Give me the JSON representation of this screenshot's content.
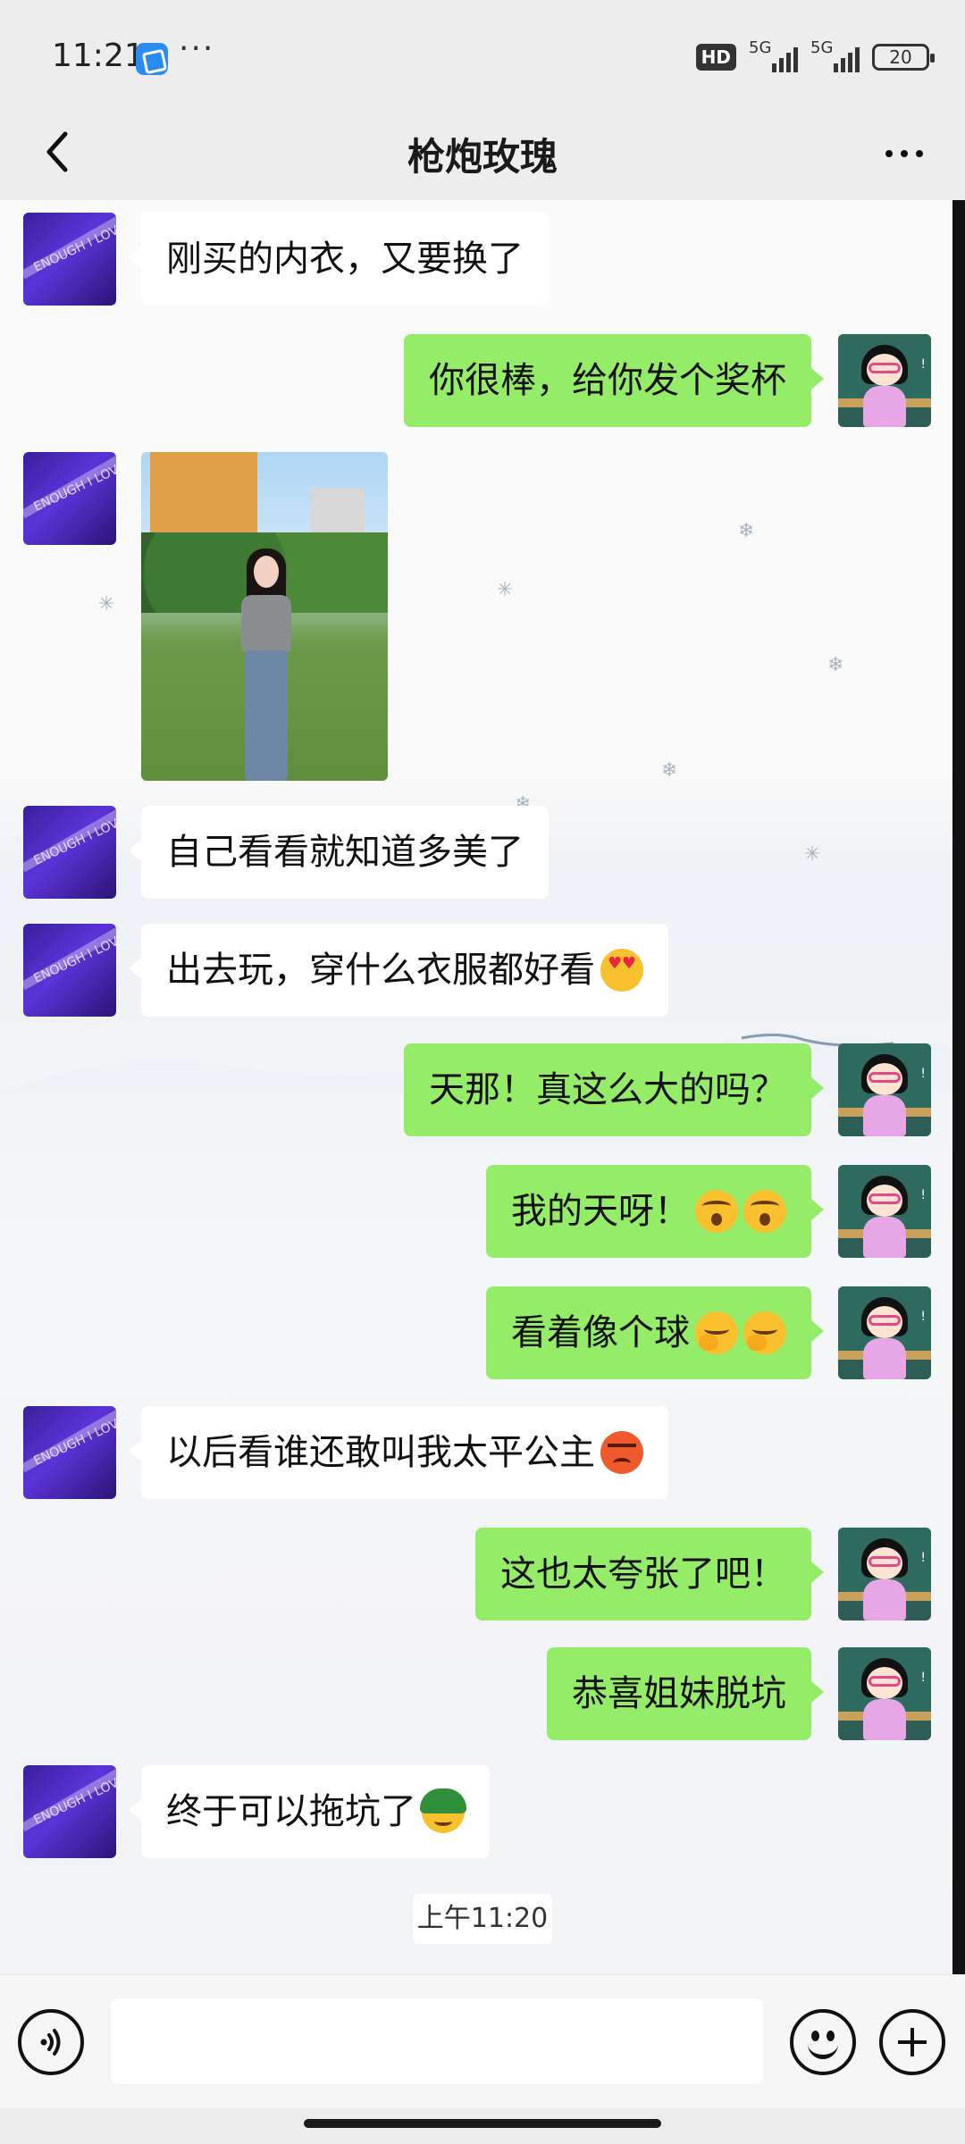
{
  "status_bar": {
    "time": "11:21",
    "more": "···",
    "hd_label": "HD",
    "signal1": "5G",
    "signal2": "5G",
    "battery": "20"
  },
  "header": {
    "title": "枪炮玫瑰",
    "back_icon": "chevron-left-icon",
    "more_icon": "more-dots-icon"
  },
  "contact_avatar_text": "ENOUGH I LOVE YOU",
  "messages": [
    {
      "side": "left",
      "text": "刚买的内衣，又要换了"
    },
    {
      "side": "right",
      "text": "你很棒，给你发个奖杯"
    },
    {
      "side": "left",
      "type": "image",
      "alt": "photo"
    },
    {
      "side": "left",
      "text": "自己看看就知道多美了"
    },
    {
      "side": "left",
      "text": "出去玩，穿什么衣服都好看",
      "emoji": "heart-eyes-emoji"
    },
    {
      "side": "right",
      "text": "天那！真这么大的吗？"
    },
    {
      "side": "right",
      "text": "我的天呀！",
      "emoji": "shocked-emoji"
    },
    {
      "side": "right",
      "text": "看着像个球",
      "emoji": "giggle-emoji"
    },
    {
      "side": "left",
      "text": "以后看谁还敢叫我太平公主",
      "emoji": "angry-emoji"
    },
    {
      "side": "right",
      "text": "这也太夸张了吧！"
    },
    {
      "side": "right",
      "text": "恭喜姐妹脱坑"
    },
    {
      "side": "left",
      "text": "终于可以拖坑了",
      "emoji": "helmet-emoji"
    }
  ],
  "timestamp": "上午11:20",
  "input": {
    "placeholder": "",
    "value": ""
  },
  "colors": {
    "self_bubble": "#95ec69",
    "other_bubble": "#ffffff",
    "background": "#ededed"
  }
}
